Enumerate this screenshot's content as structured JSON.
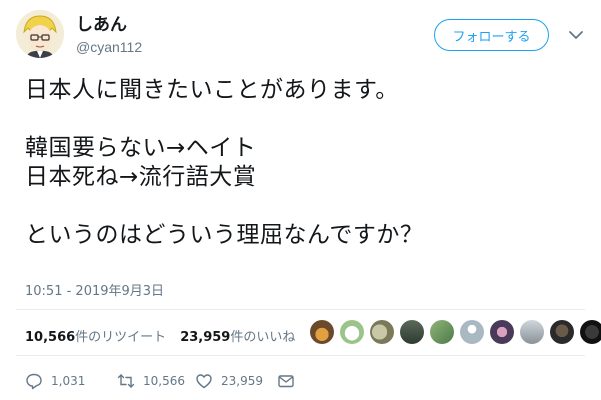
{
  "user": {
    "display_name": "しあん",
    "handle": "@cyan112"
  },
  "follow_label": "フォローする",
  "tweet": {
    "lines": [
      "日本人に聞きたいことがあります。",
      "",
      "韓国要らない→ヘイト",
      "日本死ね→流行語大賞",
      "",
      "というのはどういう理屈なんですか？"
    ],
    "timestamp": "10:51 - 2019年9月3日"
  },
  "stats": {
    "retweets_count": "10,566",
    "retweets_label": "件のリツイート",
    "likes_count": "23,959",
    "likes_label": "件のいいね"
  },
  "actions": {
    "reply_count": "1,031",
    "retweet_count": "10,566",
    "like_count": "23,959"
  },
  "colors": {
    "accent": "#1da1f2",
    "muted": "#657786",
    "divider": "#e6ecf0"
  },
  "icons": [
    "chevron-down-icon",
    "reply-icon",
    "retweet-icon",
    "like-icon",
    "message-icon"
  ]
}
